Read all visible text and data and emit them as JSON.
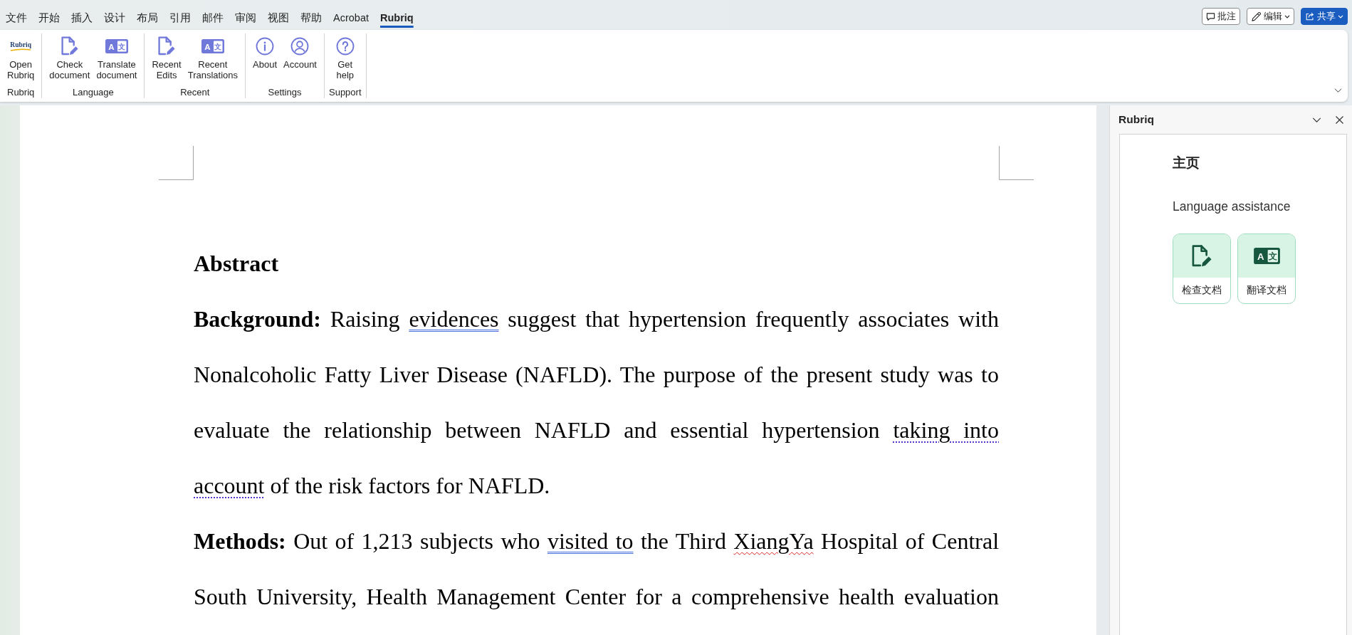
{
  "menu_tabs": [
    {
      "label": "文件",
      "selected": false
    },
    {
      "label": "开始",
      "selected": false
    },
    {
      "label": "插入",
      "selected": false
    },
    {
      "label": "设计",
      "selected": false
    },
    {
      "label": "布局",
      "selected": false
    },
    {
      "label": "引用",
      "selected": false
    },
    {
      "label": "邮件",
      "selected": false
    },
    {
      "label": "审阅",
      "selected": false
    },
    {
      "label": "视图",
      "selected": false
    },
    {
      "label": "帮助",
      "selected": false
    },
    {
      "label": "Acrobat",
      "selected": false
    },
    {
      "label": "Rubriq",
      "selected": true
    }
  ],
  "actions": [
    {
      "label": "批注",
      "kind": "comment",
      "dropdown": false,
      "primary": false
    },
    {
      "label": "编辑",
      "kind": "edit",
      "dropdown": true,
      "primary": false
    },
    {
      "label": "共享",
      "kind": "share",
      "dropdown": true,
      "primary": true
    }
  ],
  "ribbon": {
    "groups": [
      {
        "label": "Rubriq",
        "buttons": [
          {
            "kind": "logo",
            "label": "Open Rubriq",
            "logo_text": "Rubriq"
          }
        ]
      },
      {
        "label": "Language",
        "buttons": [
          {
            "kind": "document",
            "label": "Check document"
          },
          {
            "kind": "translate",
            "label": "Translate document",
            "icon_glyphs": [
              "A",
              "文"
            ]
          }
        ]
      },
      {
        "label": "Recent",
        "buttons": [
          {
            "kind": "document",
            "label": "Recent Edits"
          },
          {
            "kind": "translate",
            "label": "Recent Translations",
            "icon_glyphs": [
              "A",
              "文"
            ]
          }
        ]
      },
      {
        "label": "Settings",
        "buttons": [
          {
            "kind": "info",
            "label": "About"
          },
          {
            "kind": "account",
            "label": "Account"
          }
        ]
      },
      {
        "label": "Support",
        "buttons": [
          {
            "kind": "help",
            "label": "Get help"
          }
        ]
      }
    ]
  },
  "document": {
    "paragraphs": [
      {
        "kind": "heading",
        "runs": [
          {
            "kind": "plain",
            "text": "Abstract"
          }
        ]
      },
      {
        "kind": "body",
        "runs": [
          {
            "kind": "plain",
            "text": "**Background:** Raising "
          },
          {
            "kind": "grammar",
            "text": "evidences"
          },
          {
            "kind": "plain",
            "text": " suggest that hypertension frequently associates with Nonalcoholic Fatty Liver Disease (NAFLD). The purpose of the present study was to evaluate the relationship between NAFLD and essential hypertension "
          },
          {
            "kind": "clarity",
            "text": "taking into account"
          },
          {
            "kind": "plain",
            "text": " of the risk factors for NAFLD."
          }
        ]
      },
      {
        "kind": "body",
        "runs": [
          {
            "kind": "plain",
            "text": "**Methods:** Out of 1,213 subjects who "
          },
          {
            "kind": "grammar",
            "text": "visited to"
          },
          {
            "kind": "plain",
            "text": " the Third "
          },
          {
            "kind": "spelling",
            "text": "XiangYa"
          },
          {
            "kind": "plain",
            "text": " Hospital of Central South University, Health Management Center for a comprehensive health evaluation"
          }
        ]
      }
    ]
  },
  "task_pane": {
    "title": "Rubriq",
    "heading": "主页",
    "section": "Language assistance",
    "cards": [
      {
        "kind": "document",
        "label": "检查文档"
      },
      {
        "kind": "translate",
        "label": "翻译文档",
        "icon_glyphs": [
          "A",
          "文"
        ]
      }
    ]
  }
}
